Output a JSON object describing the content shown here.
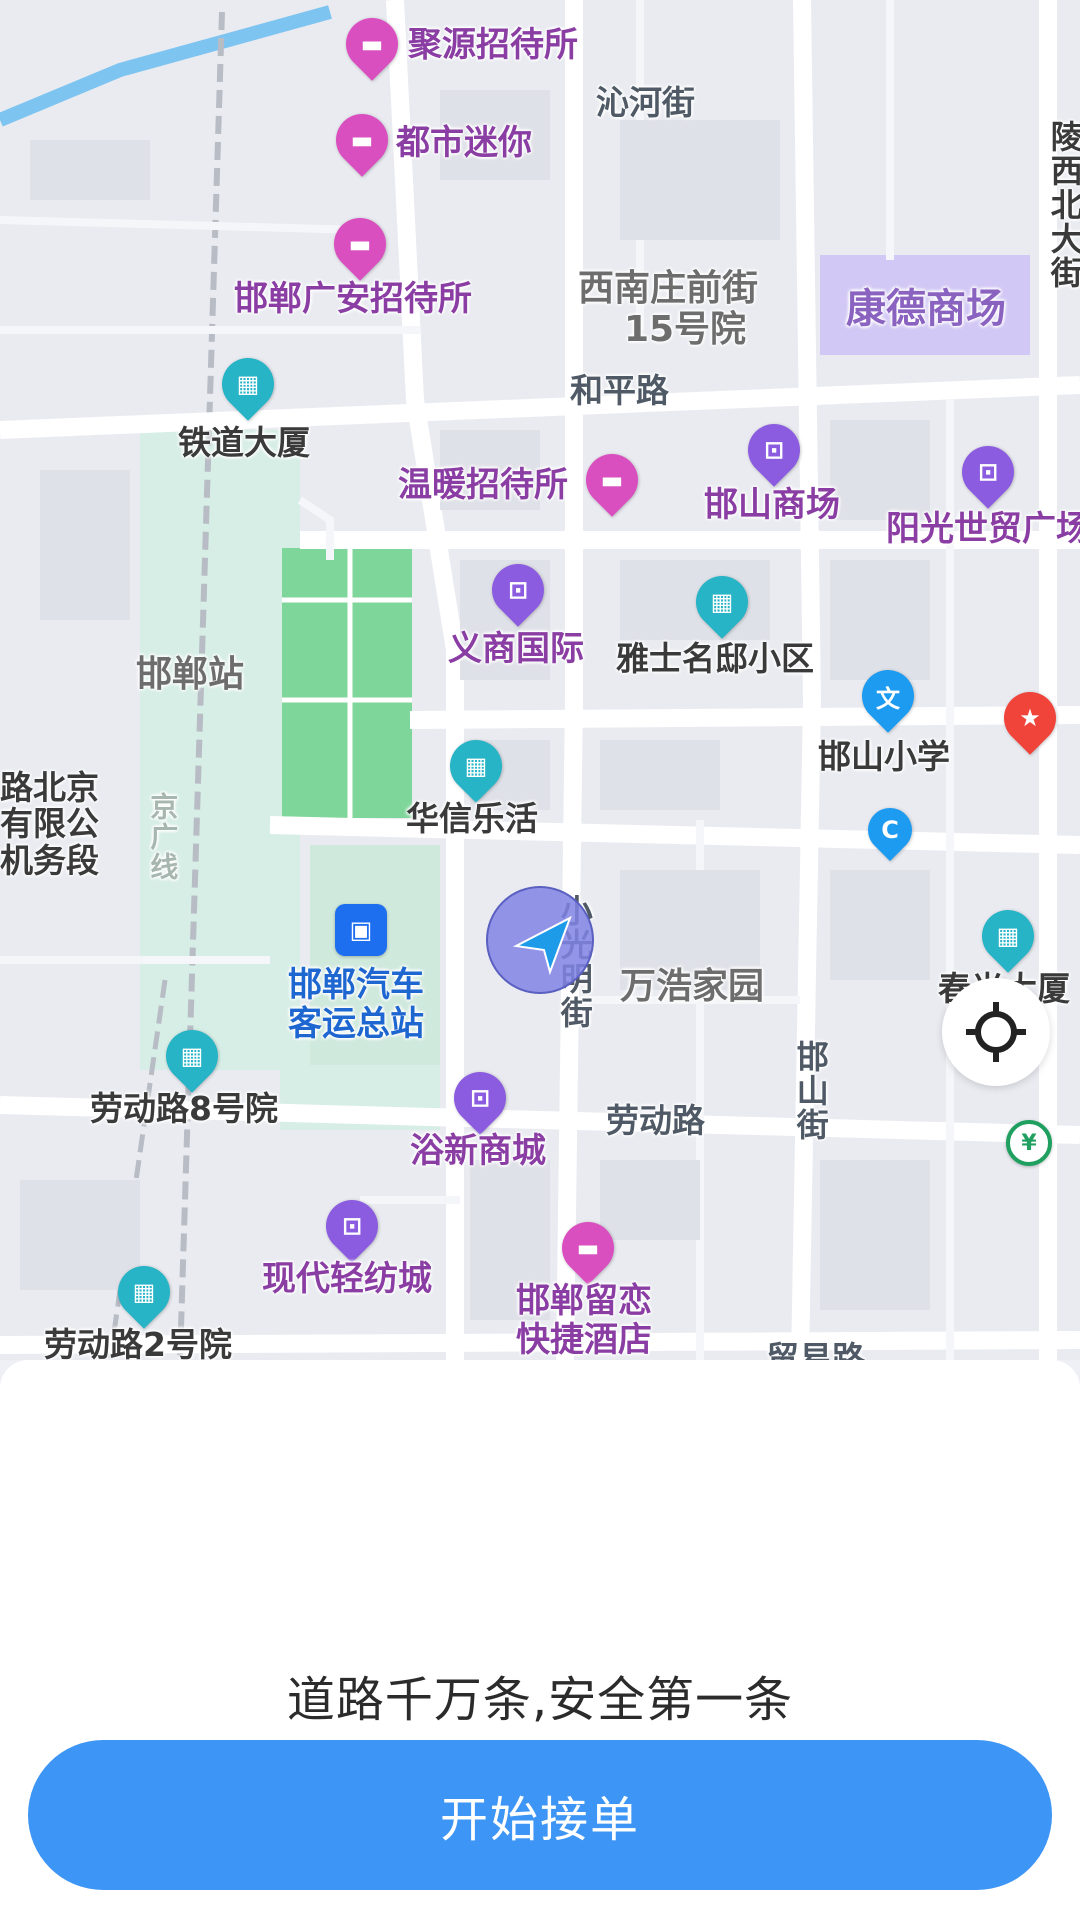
{
  "map": {
    "pois": {
      "juyuan": "聚源招待所",
      "dushi": "都市迷你",
      "guangan": "邯郸广安招待所",
      "tiedao": "铁道大厦",
      "wennuan": "温暖招待所",
      "handan_shangchang": "邯山商场",
      "yangguang": "阳光世贸广场",
      "yishang": "义商国际",
      "yashi": "雅士名邸小区",
      "handan_zhan": "邯郸站",
      "handan_xiaoxue": "邯山小学",
      "huaxin": "华信乐活",
      "bus_station_1": "邯郸汽车",
      "bus_station_2": "客运总站",
      "wanhao": "万浩家园",
      "laodong8": "劳动路8号院",
      "yuxin": "浴新商城",
      "xiandai": "现代轻纺城",
      "liulian_1": "邯郸留恋",
      "liulian_2": "快捷酒店",
      "laodong2": "劳动路2号院",
      "xinan_1": "西南庄前街",
      "xinan_2": "15号院",
      "kangde": "康德商场",
      "chunshi": "春光大厦",
      "railway_1": "路北京",
      "railway_2": "有限公",
      "railway_3": "机务段"
    },
    "streets": {
      "qinhe": "沁河街",
      "heping": "和平路",
      "laodong": "劳动路",
      "xiaoguangming": "小光明街",
      "hanshan": "邯山街",
      "lingxi": "陵西北大街",
      "jingguang": "京广线",
      "maoyi": "贸易路"
    },
    "icons": {
      "hotel": "hotel-icon",
      "shop": "shopping-bag-icon",
      "residence": "residence-icon",
      "school": "school-icon",
      "bus": "bus-icon",
      "bank": "bank-icon",
      "location_arrow": "navigation-arrow-icon",
      "locate": "crosshair-icon"
    },
    "colors": {
      "hotel_pin": "#d94fc0",
      "shop_pin": "#8c5ce0",
      "residence_pin": "#27b4c6",
      "park": "#7fd69a",
      "location_disc": "#8a8fe6",
      "accent": "#3d95f5"
    }
  },
  "bottom_sheet": {
    "slogan": "道路千万条,安全第一条",
    "start_button_label": "开始接单"
  }
}
